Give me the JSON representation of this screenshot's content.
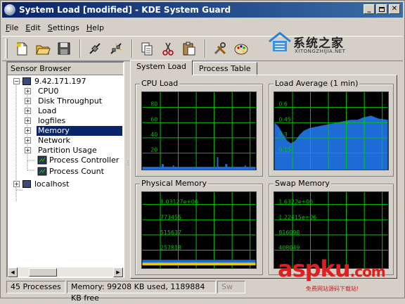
{
  "window": {
    "title": "System Load [modified] - KDE System Guard"
  },
  "menu": [
    {
      "underline": "F",
      "rest": "ile"
    },
    {
      "underline": "E",
      "rest": "dit"
    },
    {
      "underline": "S",
      "rest": "ettings"
    },
    {
      "underline": "H",
      "rest": "elp"
    }
  ],
  "toolbar_icons": [
    "new-icon",
    "open-icon",
    "save-icon",
    "connect-icon",
    "disconnect-icon",
    "copy-icon",
    "cut-icon",
    "paste-icon",
    "tools-icon",
    "palette-icon"
  ],
  "watermark_top": {
    "cn": "系统之家",
    "en": "XITONGZHIJIA.NET"
  },
  "sensor_browser": {
    "header": "Sensor Browser",
    "host1": "9.42.171.197",
    "items": [
      "CPU0",
      "Disk Throughput",
      "Load",
      "logfiles",
      "Memory",
      "Network",
      "Partition Usage"
    ],
    "selected": "Memory",
    "sensors": [
      "Process Controller",
      "Process Count"
    ],
    "host2": "localhost"
  },
  "tabs": [
    "System Load",
    "Process Table"
  ],
  "displays": {
    "cpu": {
      "title": "CPU Load",
      "ticks": [
        "80",
        "60",
        "40",
        "20"
      ]
    },
    "load": {
      "title": "Load Average (1 min)",
      "ticks": [
        "0.6",
        "0.45",
        "0.3",
        "0.15"
      ]
    },
    "phys": {
      "title": "Physical Memory",
      "ticks": [
        "1.03127e+06",
        "773455",
        "515637",
        "257818"
      ]
    },
    "swap": {
      "title": "Swap Memory",
      "ticks": [
        "1.6322e+06",
        "1.22415e+06",
        "816098",
        "408049"
      ]
    }
  },
  "status": {
    "processes": "45 Processes",
    "memory": "Memory: 99208 KB used, 1189884 KB free",
    "swap": "Sw"
  },
  "watermark_bottom": {
    "main": "aspku",
    "com": ".com",
    "sub": "免费网站源码下载站!"
  },
  "colors": {
    "grid": "#00c800",
    "plot_bg": "#000000",
    "series": "#1e6bd6",
    "title_bar": "#0a246a",
    "selection": "#0a246a"
  }
}
